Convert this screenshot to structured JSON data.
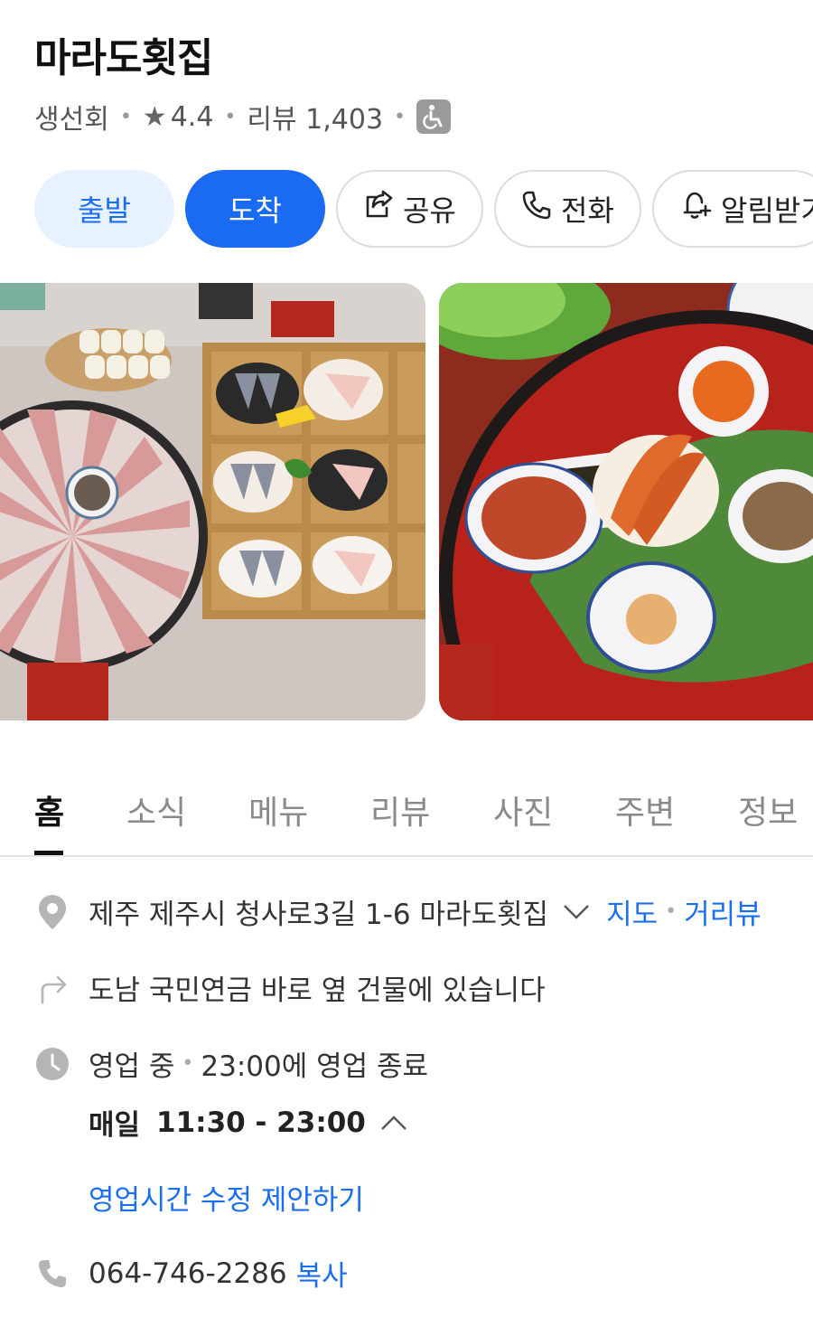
{
  "place": {
    "name": "마라도횟집",
    "category": "생선회",
    "rating": "4.4",
    "reviews_label": "리뷰 1,403",
    "accessibility_icon": "wheelchair-icon"
  },
  "actions": {
    "depart": "출발",
    "arrive": "도착",
    "share": "공유",
    "call": "전화",
    "alert": "알림받기"
  },
  "photos": [
    {
      "icon": "sashimi-platter-photo"
    },
    {
      "icon": "side-dishes-photo"
    }
  ],
  "tabs": [
    "홈",
    "소식",
    "메뉴",
    "리뷰",
    "사진",
    "주변",
    "정보"
  ],
  "active_tab": "홈",
  "info": {
    "address": "제주 제주시 청사로3길 1-6 마라도횟집",
    "map_link": "지도",
    "street_view_link": "거리뷰",
    "directions": "도남 국민연금 바로 옆 건물에 있습니다",
    "status": "영업 중",
    "closing": "23:00에 영업 종료",
    "hours_day": "매일",
    "hours_time": "11:30 - 23:00",
    "edit_hours_link": "영업시간 수정 제안하기",
    "phone": "064-746-2286",
    "copy_link": "복사"
  },
  "colors": {
    "accent": "#1b6af2",
    "accent_light": "#e8f1ff",
    "muted_icon": "#b5b5b5"
  }
}
